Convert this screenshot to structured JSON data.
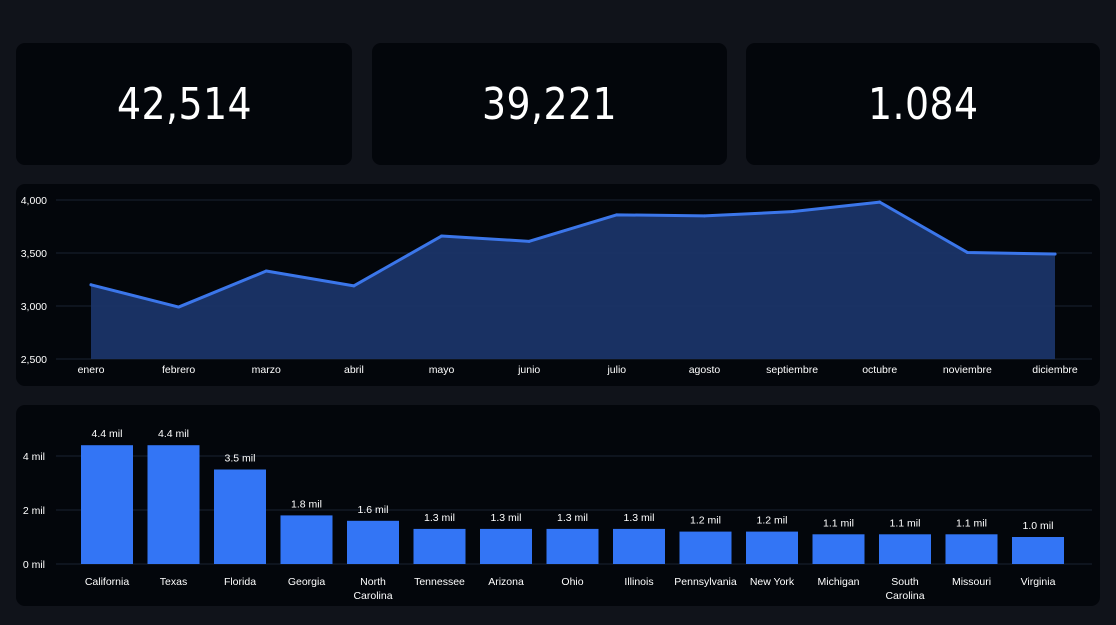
{
  "kpis": [
    {
      "value": "42,514"
    },
    {
      "value": "39,221"
    },
    {
      "value": "1.084"
    }
  ],
  "colors": {
    "background": "#10131a",
    "card": "#03060b",
    "line": "#3b76ea",
    "area": "#1a3468",
    "bar": "#3375f5",
    "grid": "#1a2130",
    "text": "#ffffff"
  },
  "chart_data": [
    {
      "type": "area",
      "title": "",
      "xlabel": "",
      "ylabel": "",
      "categories": [
        "enero",
        "febrero",
        "marzo",
        "abril",
        "mayo",
        "junio",
        "julio",
        "agosto",
        "septiembre",
        "octubre",
        "noviembre",
        "diciembre"
      ],
      "values": [
        3200,
        2990,
        3330,
        3190,
        3660,
        3610,
        3860,
        3850,
        3890,
        3980,
        3505,
        3490
      ],
      "ylim": [
        2500,
        4000
      ],
      "yticks": [
        2500,
        3000,
        3500,
        4000
      ],
      "ytick_labels": [
        "2,500",
        "3,000",
        "3,500",
        "4,000"
      ],
      "grid": true
    },
    {
      "type": "bar",
      "title": "",
      "xlabel": "",
      "ylabel": "",
      "categories": [
        "California",
        "Texas",
        "Florida",
        "Georgia",
        "North Carolina",
        "Tennessee",
        "Arizona",
        "Ohio",
        "Illinois",
        "Pennsylvania",
        "New York",
        "Michigan",
        "South Carolina",
        "Missouri",
        "Virginia"
      ],
      "values": [
        4400,
        4400,
        3500,
        1800,
        1600,
        1300,
        1300,
        1300,
        1300,
        1200,
        1200,
        1100,
        1100,
        1100,
        1000
      ],
      "data_labels": [
        "4.4 mil",
        "4.4 mil",
        "3.5 mil",
        "1.8 mil",
        "1.6 mil",
        "1.3 mil",
        "1.3 mil",
        "1.3 mil",
        "1.3 mil",
        "1.2 mil",
        "1.2 mil",
        "1.1 mil",
        "1.1 mil",
        "1.1 mil",
        "1.0 mil"
      ],
      "ylim": [
        0,
        5000
      ],
      "yticks": [
        0,
        2000,
        4000
      ],
      "ytick_labels": [
        "0 mil",
        "2 mil",
        "4 mil"
      ],
      "grid": true
    }
  ]
}
